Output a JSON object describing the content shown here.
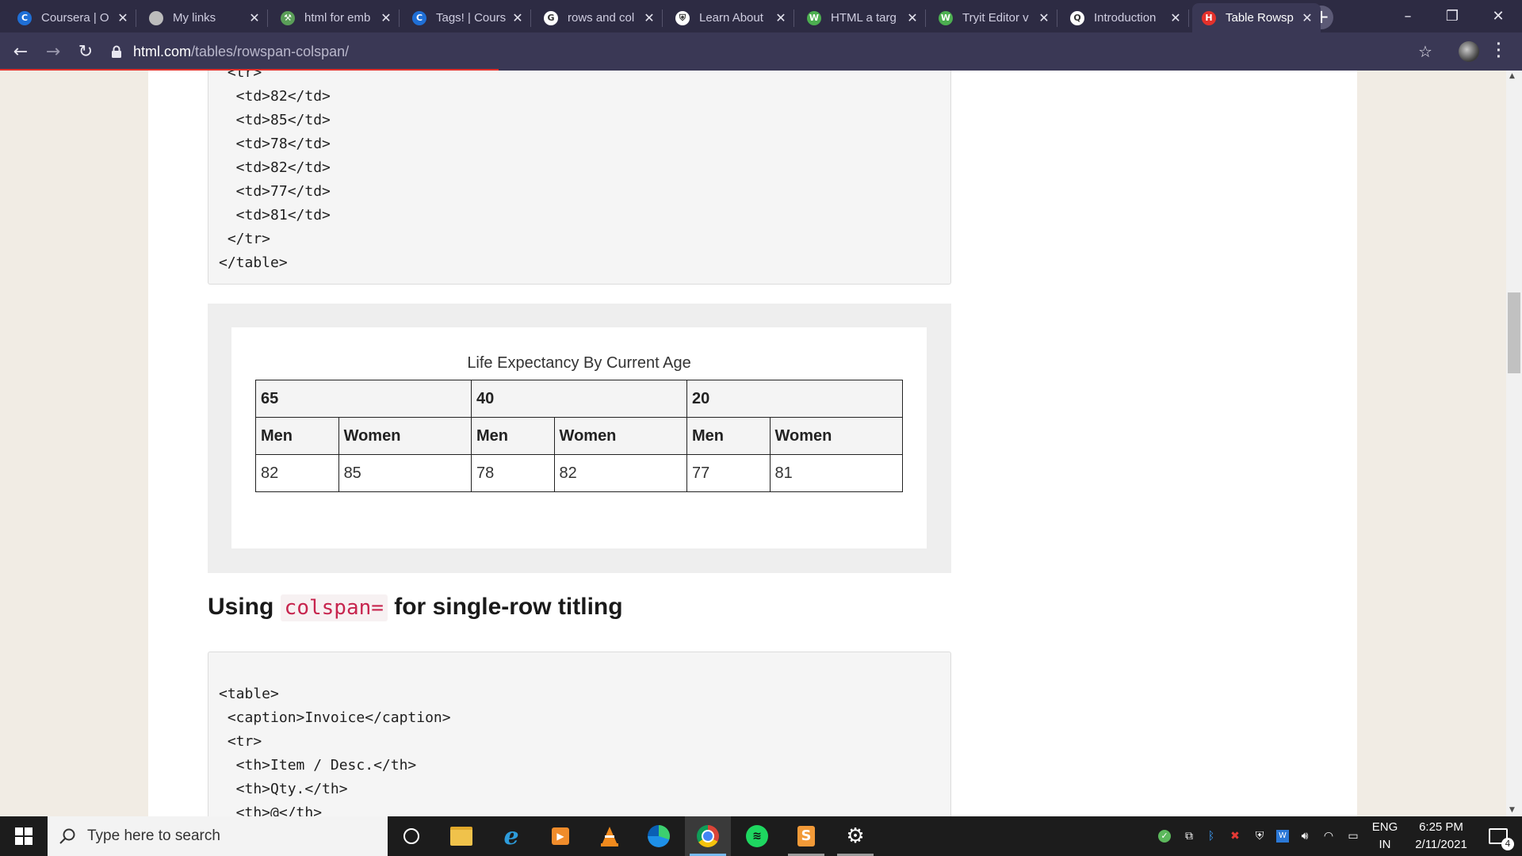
{
  "browser": {
    "tabs": [
      {
        "title": "Coursera | O",
        "icon": "coursera-icon",
        "color": "#1f6fd6",
        "glyph": "C"
      },
      {
        "title": "My links",
        "icon": "globe-icon",
        "color": "#bcbcbc",
        "glyph": ""
      },
      {
        "title": "html for emb",
        "icon": "tool-icon",
        "color": "#5a9e58",
        "glyph": "⚒"
      },
      {
        "title": "Tags! | Cours",
        "icon": "coursera-icon",
        "color": "#1f6fd6",
        "glyph": "C"
      },
      {
        "title": "rows and col",
        "icon": "google-icon",
        "color": "#ffffff",
        "glyph": "G"
      },
      {
        "title": "Learn About",
        "icon": "shield-icon",
        "color": "#ffffff",
        "glyph": "⛨"
      },
      {
        "title": "HTML a targ",
        "icon": "w3schools-icon",
        "color": "#4caf50",
        "glyph": "W"
      },
      {
        "title": "Tryit Editor v",
        "icon": "w3schools-icon",
        "color": "#4caf50",
        "glyph": "W"
      },
      {
        "title": "Introduction",
        "icon": "search-site-icon",
        "color": "#ffffff",
        "glyph": "Q"
      },
      {
        "title": "Table Rowsp",
        "icon": "html-com-icon",
        "color": "#e4312b",
        "glyph": "H"
      }
    ],
    "url_host": "html.com",
    "url_path": "/tables/rowspan-colspan/"
  },
  "code_top": {
    "lines": [
      " <tr>",
      "  <td>82</td>",
      "  <td>85</td>",
      "  <td>78</td>",
      "  <td>82</td>",
      "  <td>77</td>",
      "  <td>81</td>",
      " </tr>",
      "</table>"
    ]
  },
  "demo": {
    "caption": "Life Expectancy By Current Age",
    "ages": [
      "65",
      "40",
      "20"
    ],
    "genders": [
      "Men",
      "Women",
      "Men",
      "Women",
      "Men",
      "Women"
    ],
    "values": [
      "82",
      "85",
      "78",
      "82",
      "77",
      "81"
    ]
  },
  "section": {
    "heading_before": "Using ",
    "heading_code": "colspan=",
    "heading_after": " for single-row titling"
  },
  "code_bottom": {
    "lines": [
      "<table>",
      " <caption>Invoice</caption>",
      " <tr>",
      "  <th>Item / Desc.</th>",
      "  <th>Qty.</th>",
      "  <th>@</th>"
    ]
  },
  "taskbar": {
    "search_placeholder": "Type here to search",
    "lang_top": "ENG",
    "lang_bottom": "IN",
    "time": "6:25 PM",
    "date": "2/11/2021",
    "notification_count": "4"
  }
}
